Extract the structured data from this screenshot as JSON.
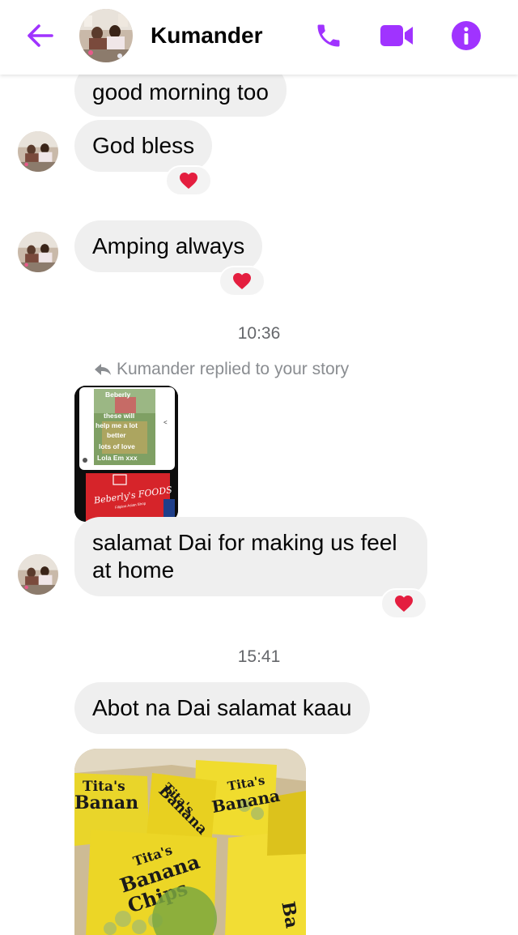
{
  "header": {
    "title": "Kumander",
    "back_icon": "arrow-left-icon",
    "call_icon": "phone-icon",
    "video_icon": "video-camera-icon",
    "info_icon": "info-icon",
    "accent_color": "#a033ff"
  },
  "messages": [
    {
      "text": "good morning too"
    },
    {
      "text": "God bless",
      "reaction": "heart"
    },
    {
      "text": "Amping always",
      "reaction": "heart"
    }
  ],
  "timestamp_1": "10:36",
  "story_reply": {
    "note": "Kumander replied to your story",
    "story_text_lines": [
      "Beberly",
      "these will",
      "help me a lot",
      "better",
      "lots of love",
      "Lola Em xxx"
    ],
    "story_brand": "Beberly's FOODS",
    "story_subbrand": "Filipino Asian Shop",
    "reply_text": "salamat Dai for making us feel at home",
    "reaction": "heart"
  },
  "timestamp_2": "15:41",
  "last_message": {
    "text": "Abot na Dai salamat kaau",
    "photo_label_1": "Tita's",
    "photo_label_2": "Banana Chips"
  },
  "colors": {
    "bubble": "#efefef",
    "heart": "#e41e3f",
    "timestamp": "#65676b"
  }
}
